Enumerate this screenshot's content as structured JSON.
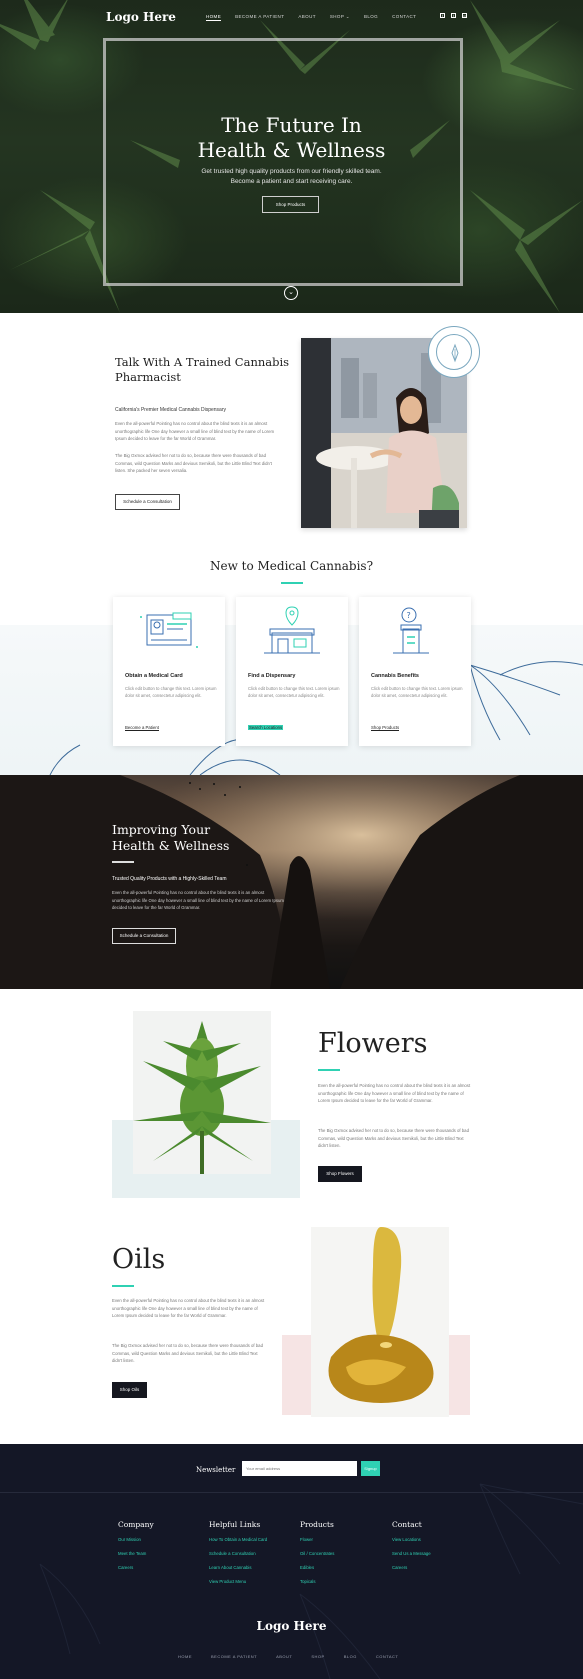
{
  "header": {
    "logo": "Logo Here",
    "nav": [
      "HOME",
      "BECOME A PATIENT",
      "ABOUT",
      "SHOP ⌄",
      "BLOG",
      "CONTACT"
    ],
    "social": [
      "facebook-icon",
      "twitter-icon",
      "instagram-icon"
    ]
  },
  "hero": {
    "title_line1": "The Future In",
    "title_line2": "Health & Wellness",
    "subtitle_line1": "Get trusted high quality products from our friendly skilled team.",
    "subtitle_line2": "Become a patient and start receiving care.",
    "button": "Shop Products",
    "scroll_icon": "chevron-down-icon"
  },
  "pharmacist": {
    "title_line1": "Talk With A Trained Cannabis",
    "title_line2": "Pharmacist",
    "subtitle": "California's Premier Medical Cannabis Dispensary",
    "paragraph1": "Even the all-powerful Pointing has no control about the blind texts it is an almost unorthographic life One day however a small line of blind text by the name of Lorem Ipsum decided to leave for the far World of Grammar.",
    "paragraph2": "The Big Oxmox advised her not to do so, because there were thousands of bad Commas, wild Question Marks and devious Semikoli, but the Little Blind Text didn't listen. She packed her seven versalia.",
    "button": "Schedule a Consultation"
  },
  "new_to_cannabis": {
    "title": "New to Medical Cannabis?",
    "cards": [
      {
        "icon": "id-card-icon",
        "title": "Obtain a Medical Card",
        "text": "Click edit button to change this text. Lorem ipsum dolor sit amet, consectetur adipiscing elit.",
        "link": "Become a Patient"
      },
      {
        "icon": "dispensary-location-icon",
        "title": "Find a Dispensary",
        "text": "Click edit button to change this text. Lorem ipsum dolor sit amet, consectetur adipiscing elit.",
        "link": "Search Locations"
      },
      {
        "icon": "cannabis-benefits-icon",
        "title": "Cannabis Benefits",
        "text": "Click edit button to change this text. Lorem ipsum dolor sit amet, consectetur adipiscing elit.",
        "link": "Shop Products"
      }
    ]
  },
  "improving": {
    "title_line1": "Improving Your",
    "title_line2": "Health & Wellness",
    "subtitle": "Trusted Quality Products with a Highly-Skilled Team",
    "paragraph": "Even the all-powerful Pointing has no control about the blind texts it is an almost unorthographic life One day however a small line of blind text by the name of Lorem Ipsum decided to leave for the far World of Grammar.",
    "button": "Schedule a Consultation"
  },
  "flowers": {
    "title": "Flowers",
    "paragraph1": "Even the all-powerful Pointing has no control about the blind texts it is an almost unorthographic life One day however a small line of blind text by the name of Lorem Ipsum decided to leave for the far World of Grammar.",
    "paragraph2": "The Big Oxmox advised her not to do so, because there were thousands of bad Commas, wild Question Marks and devious Semikoli, but the Little Blind Text didn't listen.",
    "button": "Shop Flowers"
  },
  "oils": {
    "title": "Oils",
    "paragraph1": "Even the all-powerful Pointing has no control about the blind texts it is an almost unorthographic life One day however a small line of blind text by the name of Lorem Ipsum decided to leave for the far World of Grammar.",
    "paragraph2": "The Big Oxmox advised her not to do so, because there were thousands of bad Commas, wild Question Marks and devious Semikoli, but the Little Blind Text didn't listen.",
    "button": "Shop Oils"
  },
  "newsletter": {
    "label": "Newsletter",
    "placeholder": "Your email address",
    "button": "Signup"
  },
  "footer": {
    "columns": [
      {
        "title": "Company",
        "links": [
          "Our Mission",
          "Meet the Team",
          "Careers"
        ]
      },
      {
        "title": "Helpful Links",
        "links": [
          "How To Obtain a Medical Card",
          "Schedule a Consultation",
          "Learn About Cannabis",
          "View Product Menu"
        ]
      },
      {
        "title": "Products",
        "links": [
          "Flower",
          "Oil / Concentrates",
          "Edibles",
          "Topicals"
        ]
      },
      {
        "title": "Contact",
        "links": [
          "View Locations",
          "Send Us a Message",
          "Careers"
        ]
      }
    ],
    "logo": "Logo Here",
    "nav": [
      "HOME",
      "BECOME A PATIENT",
      "ABOUT",
      "SHOP",
      "BLOG",
      "CONTACT"
    ]
  },
  "colors": {
    "accent": "#2fd1b3",
    "dark": "#141726",
    "button_dark": "#15171f"
  }
}
